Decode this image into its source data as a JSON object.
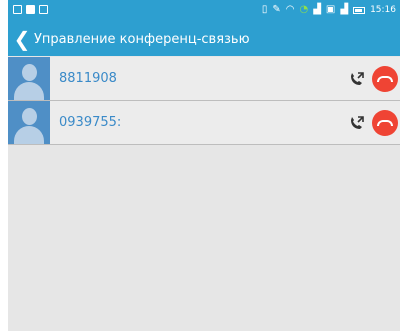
{
  "status_bar": {
    "time": "15:16"
  },
  "toolbar": {
    "title": "Управление конференц-связью"
  },
  "calls": [
    {
      "number": "8811908"
    },
    {
      "number": "0939755:"
    }
  ],
  "colors": {
    "accent": "#2d9fd0",
    "end_call": "#ef4434",
    "number_text": "#3a8ac8"
  }
}
